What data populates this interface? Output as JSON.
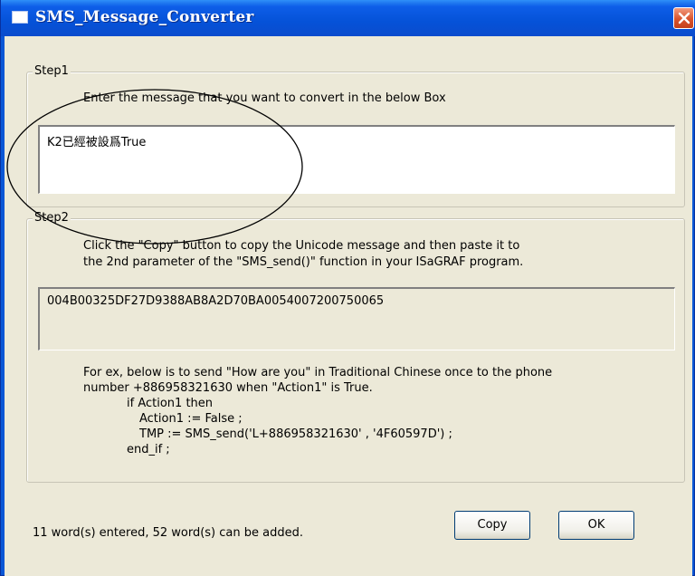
{
  "window": {
    "title": "SMS_Message_Converter"
  },
  "step1": {
    "legend": "Step1",
    "instruction": "Enter the message that you want to convert in the below Box",
    "input_value": "K2已經被設爲True"
  },
  "step2": {
    "legend": "Step2",
    "instruction_line1": "Click the \"Copy\" button to copy the Unicode message and then paste it to",
    "instruction_line2": "the 2nd parameter of the \"SMS_send()\" function in your ISaGRAF program.",
    "output_value": "004B00325DF27D9388AB8A2D70BA0054007200750065",
    "example_lines": [
      "For ex, below is to send \"How are you\" in Traditional Chinese once to the phone",
      "number +886958321630 when \"Action1\" is True.",
      "if Action1 then",
      "Action1 := False ;",
      "TMP := SMS_send('L+886958321630' , '4F60597D') ;",
      "end_if ;"
    ]
  },
  "status": {
    "text": "11 word(s) entered, 52 word(s) can be added."
  },
  "buttons": {
    "copy_label": "Copy",
    "ok_label": "OK"
  },
  "icons": {
    "app": "window-icon",
    "close": "close-icon"
  },
  "colors": {
    "titlebar": "#0552d8",
    "client_bg": "#ece9d8",
    "close_button": "#d9532c"
  }
}
